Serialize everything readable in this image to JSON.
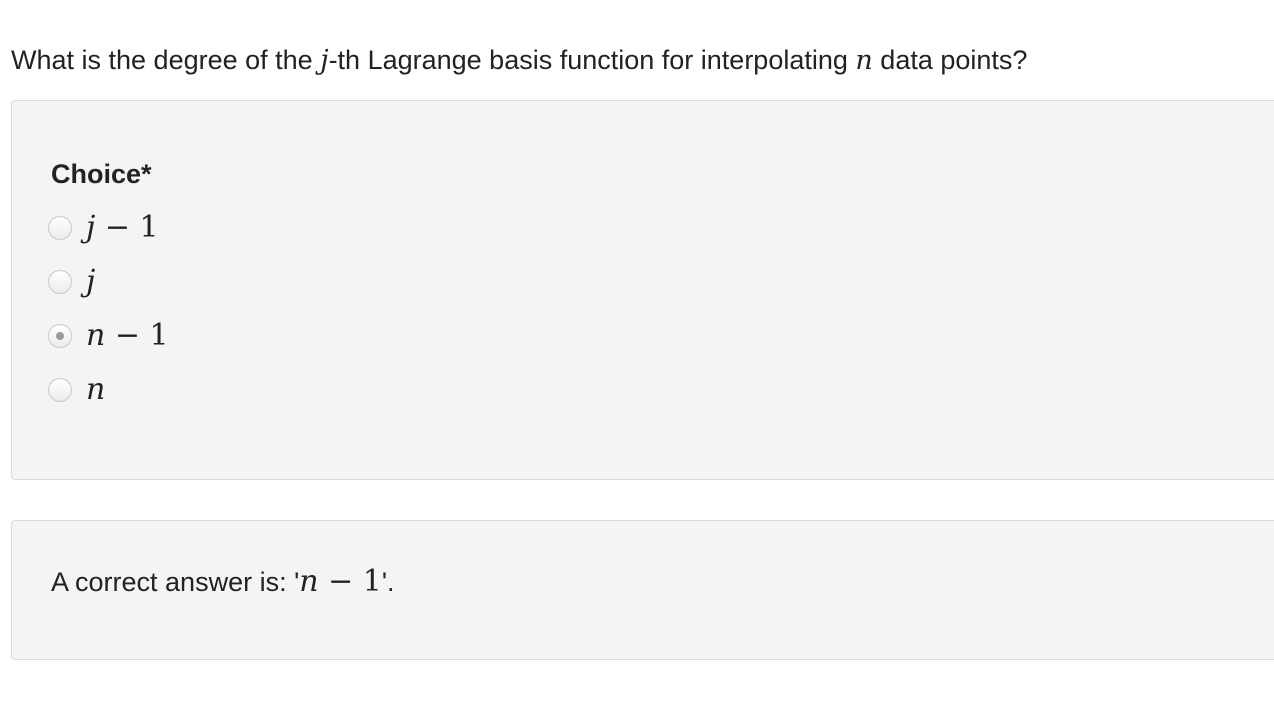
{
  "question": {
    "before": "What is the degree of the ",
    "var_j": "j",
    "middle": "-th Lagrange basis function for interpolating ",
    "var_n": "n",
    "after": " data points?"
  },
  "choices_panel": {
    "title": "Choice*",
    "options": [
      {
        "var": "j",
        "op": " − ",
        "num": "1",
        "checked": false
      },
      {
        "var": "j",
        "op": "",
        "num": "",
        "checked": false
      },
      {
        "var": "n",
        "op": " − ",
        "num": "1",
        "checked": true
      },
      {
        "var": "n",
        "op": "",
        "num": "",
        "checked": false
      }
    ]
  },
  "answer_panel": {
    "prefix": "A correct answer is: '",
    "var": "n",
    "op": " − ",
    "num": "1",
    "suffix": "'."
  }
}
